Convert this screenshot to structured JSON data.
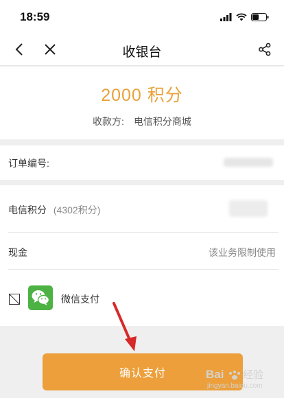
{
  "status_bar": {
    "time": "18:59"
  },
  "nav": {
    "title": "收银台"
  },
  "amount": {
    "value": "2000 积分",
    "payee_label": "收款方:",
    "payee_name": "电信积分商城"
  },
  "order": {
    "label": "订单编号:"
  },
  "payment": {
    "points_label": "电信积分",
    "points_available": "(4302积分)",
    "cash_label": "现金",
    "cash_hint": "该业务限制使用",
    "wechat_label": "微信支付"
  },
  "confirm_label": "确认支付",
  "watermark": "Bai du 经验\njingyan.baidu.com",
  "colors": {
    "accent": "#ec9f3a",
    "amount": "#e8a23a",
    "wechat": "#4cb243",
    "arrow": "#d62a2a"
  }
}
